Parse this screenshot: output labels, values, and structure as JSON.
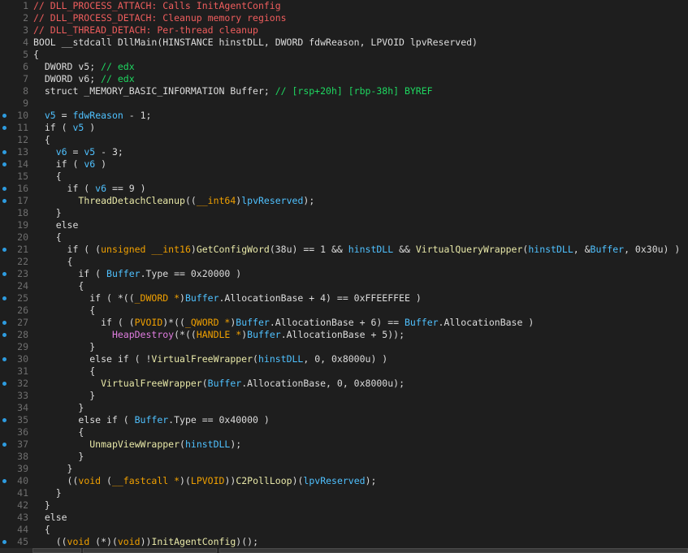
{
  "editor": {
    "lines": [
      {
        "n": "1",
        "bp": false,
        "tokens": [
          [
            "// DLL_PROCESS_ATTACH: Calls InitAgentConfig",
            "cm"
          ]
        ]
      },
      {
        "n": "2",
        "bp": false,
        "tokens": [
          [
            "// DLL_PROCESS_DETACH: Cleanup memory regions",
            "cm"
          ]
        ]
      },
      {
        "n": "3",
        "bp": false,
        "tokens": [
          [
            "// DLL_THREAD_DETACH: Per-thread cleanup",
            "cm"
          ]
        ]
      },
      {
        "n": "4",
        "bp": false,
        "tokens": [
          [
            "BOOL __stdcall DllMain(HINSTANCE hinstDLL, DWORD fdwReason, LPVOID lpvReserved)",
            "p"
          ]
        ]
      },
      {
        "n": "5",
        "bp": false,
        "tokens": [
          [
            "{",
            "p"
          ]
        ]
      },
      {
        "n": "6",
        "bp": false,
        "tokens": [
          [
            "  DWORD v5; ",
            "p"
          ],
          [
            "// edx",
            "gr"
          ]
        ]
      },
      {
        "n": "7",
        "bp": false,
        "tokens": [
          [
            "  DWORD v6; ",
            "p"
          ],
          [
            "// edx",
            "gr"
          ]
        ]
      },
      {
        "n": "8",
        "bp": false,
        "tokens": [
          [
            "  struct _MEMORY_BASIC_INFORMATION Buffer; ",
            "p"
          ],
          [
            "// [rsp+20h] [rbp-38h] BYREF",
            "gr"
          ]
        ]
      },
      {
        "n": "9",
        "bp": false,
        "tokens": [
          [
            "",
            "p"
          ]
        ]
      },
      {
        "n": "10",
        "bp": true,
        "tokens": [
          [
            "  ",
            "p"
          ],
          [
            "v5",
            "v"
          ],
          [
            " = ",
            "p"
          ],
          [
            "fdwReason",
            "v"
          ],
          [
            " - 1;",
            "p"
          ]
        ]
      },
      {
        "n": "11",
        "bp": true,
        "tokens": [
          [
            "  if ( ",
            "p"
          ],
          [
            "v5",
            "v"
          ],
          [
            " )",
            "p"
          ]
        ]
      },
      {
        "n": "12",
        "bp": false,
        "tokens": [
          [
            "  {",
            "p"
          ]
        ]
      },
      {
        "n": "13",
        "bp": true,
        "tokens": [
          [
            "    ",
            "p"
          ],
          [
            "v6",
            "v"
          ],
          [
            " = ",
            "p"
          ],
          [
            "v5",
            "v"
          ],
          [
            " - 3;",
            "p"
          ]
        ]
      },
      {
        "n": "14",
        "bp": true,
        "tokens": [
          [
            "    if ( ",
            "p"
          ],
          [
            "v6",
            "v"
          ],
          [
            " )",
            "p"
          ]
        ]
      },
      {
        "n": "15",
        "bp": false,
        "tokens": [
          [
            "    {",
            "p"
          ]
        ]
      },
      {
        "n": "16",
        "bp": true,
        "tokens": [
          [
            "      if ( ",
            "p"
          ],
          [
            "v6",
            "v"
          ],
          [
            " == 9 )",
            "p"
          ]
        ]
      },
      {
        "n": "17",
        "bp": true,
        "tokens": [
          [
            "        ",
            "p"
          ],
          [
            "ThreadDetachCleanup",
            "fn"
          ],
          [
            "((",
            "p"
          ],
          [
            "__int64",
            "ty"
          ],
          [
            ")",
            "p"
          ],
          [
            "lpvReserved",
            "v"
          ],
          [
            ");",
            "p"
          ]
        ]
      },
      {
        "n": "18",
        "bp": false,
        "tokens": [
          [
            "    }",
            "p"
          ]
        ]
      },
      {
        "n": "19",
        "bp": false,
        "tokens": [
          [
            "    else",
            "p"
          ]
        ]
      },
      {
        "n": "20",
        "bp": false,
        "tokens": [
          [
            "    {",
            "p"
          ]
        ]
      },
      {
        "n": "21",
        "bp": true,
        "tokens": [
          [
            "      if ( (",
            "p"
          ],
          [
            "unsigned __int16",
            "ty"
          ],
          [
            ")",
            "p"
          ],
          [
            "GetConfigWord",
            "fn"
          ],
          [
            "(38u) == 1 && ",
            "p"
          ],
          [
            "hinstDLL",
            "v"
          ],
          [
            " && ",
            "p"
          ],
          [
            "VirtualQueryWrapper",
            "fn"
          ],
          [
            "(",
            "p"
          ],
          [
            "hinstDLL",
            "v"
          ],
          [
            ", &",
            "p"
          ],
          [
            "Buffer",
            "v"
          ],
          [
            ", 0x30u) )",
            "p"
          ]
        ]
      },
      {
        "n": "22",
        "bp": false,
        "tokens": [
          [
            "      {",
            "p"
          ]
        ]
      },
      {
        "n": "23",
        "bp": true,
        "tokens": [
          [
            "        if ( ",
            "p"
          ],
          [
            "Buffer",
            "v"
          ],
          [
            ".Type == 0x20000 )",
            "p"
          ]
        ]
      },
      {
        "n": "24",
        "bp": false,
        "tokens": [
          [
            "        {",
            "p"
          ]
        ]
      },
      {
        "n": "25",
        "bp": true,
        "tokens": [
          [
            "          if ( *((",
            "p"
          ],
          [
            "_DWORD *",
            "ty"
          ],
          [
            ")",
            "p"
          ],
          [
            "Buffer",
            "v"
          ],
          [
            ".AllocationBase + 4) == 0xFFEEFFEE )",
            "p"
          ]
        ]
      },
      {
        "n": "26",
        "bp": false,
        "tokens": [
          [
            "          {",
            "p"
          ]
        ]
      },
      {
        "n": "27",
        "bp": true,
        "tokens": [
          [
            "            if ( (",
            "p"
          ],
          [
            "PVOID",
            "ty"
          ],
          [
            ")*((",
            "p"
          ],
          [
            "_QWORD *",
            "ty"
          ],
          [
            ")",
            "p"
          ],
          [
            "Buffer",
            "v"
          ],
          [
            ".AllocationBase + 6) == ",
            "p"
          ],
          [
            "Buffer",
            "v"
          ],
          [
            ".AllocationBase )",
            "p"
          ]
        ]
      },
      {
        "n": "28",
        "bp": true,
        "tokens": [
          [
            "              ",
            "p"
          ],
          [
            "HeapDestroy",
            "fx"
          ],
          [
            "(*((",
            "p"
          ],
          [
            "HANDLE *",
            "ty"
          ],
          [
            ")",
            "p"
          ],
          [
            "Buffer",
            "v"
          ],
          [
            ".AllocationBase + 5));",
            "p"
          ]
        ]
      },
      {
        "n": "29",
        "bp": false,
        "tokens": [
          [
            "          }",
            "p"
          ]
        ]
      },
      {
        "n": "30",
        "bp": true,
        "tokens": [
          [
            "          else if ( !",
            "p"
          ],
          [
            "VirtualFreeWrapper",
            "fn"
          ],
          [
            "(",
            "p"
          ],
          [
            "hinstDLL",
            "v"
          ],
          [
            ", 0, 0x8000u) )",
            "p"
          ]
        ]
      },
      {
        "n": "31",
        "bp": false,
        "tokens": [
          [
            "          {",
            "p"
          ]
        ]
      },
      {
        "n": "32",
        "bp": true,
        "tokens": [
          [
            "            ",
            "p"
          ],
          [
            "VirtualFreeWrapper",
            "fn"
          ],
          [
            "(",
            "p"
          ],
          [
            "Buffer",
            "v"
          ],
          [
            ".AllocationBase, 0, 0x8000u);",
            "p"
          ]
        ]
      },
      {
        "n": "33",
        "bp": false,
        "tokens": [
          [
            "          }",
            "p"
          ]
        ]
      },
      {
        "n": "34",
        "bp": false,
        "tokens": [
          [
            "        }",
            "p"
          ]
        ]
      },
      {
        "n": "35",
        "bp": true,
        "tokens": [
          [
            "        else if ( ",
            "p"
          ],
          [
            "Buffer",
            "v"
          ],
          [
            ".Type == 0x40000 )",
            "p"
          ]
        ]
      },
      {
        "n": "36",
        "bp": false,
        "tokens": [
          [
            "        {",
            "p"
          ]
        ]
      },
      {
        "n": "37",
        "bp": true,
        "tokens": [
          [
            "          ",
            "p"
          ],
          [
            "UnmapViewWrapper",
            "fn"
          ],
          [
            "(",
            "p"
          ],
          [
            "hinstDLL",
            "v"
          ],
          [
            ");",
            "p"
          ]
        ]
      },
      {
        "n": "38",
        "bp": false,
        "tokens": [
          [
            "        }",
            "p"
          ]
        ]
      },
      {
        "n": "39",
        "bp": false,
        "tokens": [
          [
            "      }",
            "p"
          ]
        ]
      },
      {
        "n": "40",
        "bp": true,
        "tokens": [
          [
            "      ((",
            "p"
          ],
          [
            "void",
            "ty"
          ],
          [
            " (",
            "p"
          ],
          [
            "__fastcall *",
            "ty"
          ],
          [
            ")(",
            "p"
          ],
          [
            "LPVOID",
            "ty"
          ],
          [
            "))",
            "p"
          ],
          [
            "C2PollLoop",
            "fn"
          ],
          [
            ")(",
            "p"
          ],
          [
            "lpvReserved",
            "v"
          ],
          [
            ");",
            "p"
          ]
        ]
      },
      {
        "n": "41",
        "bp": false,
        "tokens": [
          [
            "    }",
            "p"
          ]
        ]
      },
      {
        "n": "42",
        "bp": false,
        "tokens": [
          [
            "  }",
            "p"
          ]
        ]
      },
      {
        "n": "43",
        "bp": false,
        "tokens": [
          [
            "  else",
            "p"
          ]
        ]
      },
      {
        "n": "44",
        "bp": false,
        "tokens": [
          [
            "  {",
            "p"
          ]
        ]
      },
      {
        "n": "45",
        "bp": true,
        "tokens": [
          [
            "    ((",
            "p"
          ],
          [
            "void",
            "ty"
          ],
          [
            " (*)(",
            "p"
          ],
          [
            "void",
            "ty"
          ],
          [
            "))",
            "p"
          ],
          [
            "InitAgentConfig",
            "fn"
          ],
          [
            ")();",
            "p"
          ]
        ]
      }
    ]
  },
  "colors": {
    "background": "#1e1e1e",
    "comment": "#ef5d5d",
    "variable": "#4fc1ff",
    "function": "#e8e8a8",
    "type": "#f0a000",
    "breakpoint_dot": "#2e9ce0"
  }
}
